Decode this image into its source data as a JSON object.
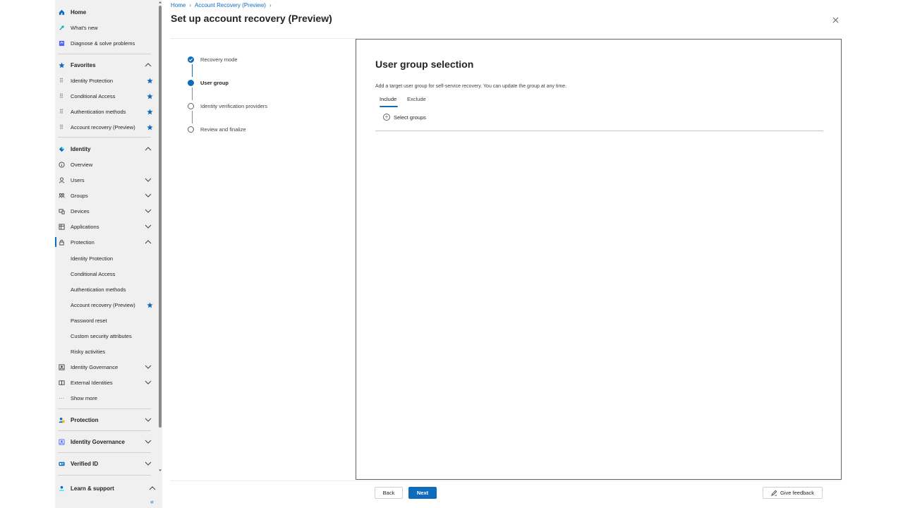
{
  "breadcrumb": {
    "home": "Home",
    "current": "Account Recovery (Preview)"
  },
  "page": {
    "title": "Set up account recovery (Preview)",
    "more": "···"
  },
  "sidebar": {
    "home": "Home",
    "whats_new": "What's new",
    "diagnose": "Diagnose & solve problems",
    "favorites": "Favorites",
    "favorite_items": [
      "Identity Protection",
      "Conditional Access",
      "Authentication methods",
      "Account recovery (Preview)"
    ],
    "identity": "Identity",
    "identity_items": [
      "Overview",
      "Users",
      "Groups",
      "Devices",
      "Applications",
      "Protection"
    ],
    "protection_items": [
      "Identity Protection",
      "Conditional Access",
      "Authentication methods",
      "Account recovery (Preview)",
      "Password reset",
      "Custom security attributes",
      "Risky activities"
    ],
    "more_items": [
      "Identity Governance",
      "External Identities"
    ],
    "show_more": "Show more",
    "sections": [
      "Protection",
      "Identity Governance",
      "Verified ID"
    ],
    "learn_support": "Learn & support",
    "collapse": "«"
  },
  "steps": [
    {
      "label": "Recovery mode",
      "state": "done"
    },
    {
      "label": "User group",
      "state": "current"
    },
    {
      "label": "Identity verification providers",
      "state": "todo"
    },
    {
      "label": "Review and finalize",
      "state": "todo"
    }
  ],
  "main": {
    "title": "User group selection",
    "description": "Add a target user group for self-service recovery. You can update the group at any time.",
    "tabs": [
      "Include",
      "Exclude"
    ],
    "select_groups": "Select groups"
  },
  "footer": {
    "back": "Back",
    "next": "Next",
    "feedback": "Give feedback"
  },
  "colors": {
    "accent": "#0f6cbd",
    "sidebar_bg": "#f0f0f0"
  }
}
